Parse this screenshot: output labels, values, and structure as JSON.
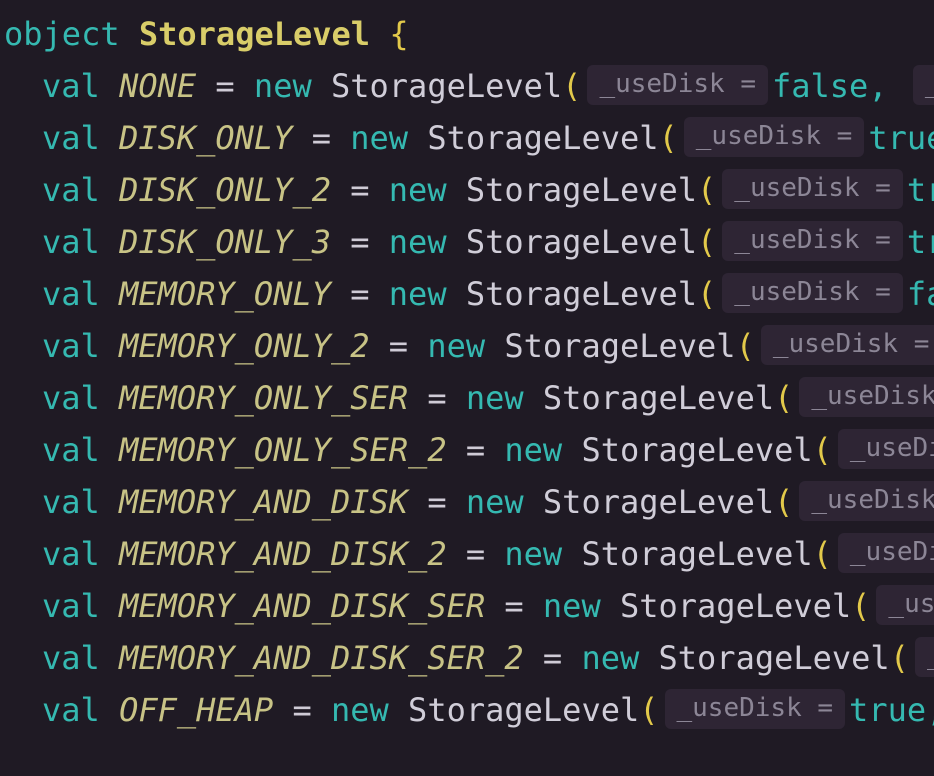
{
  "code": {
    "object_keyword": "object",
    "object_name": "StorageLevel",
    "open_brace": "{",
    "val_keyword": "val",
    "equals": "=",
    "new_keyword": "new",
    "type_name": "StorageLevel",
    "open_paren": "(",
    "param_hint": "_useDisk =",
    "lines": [
      {
        "name": "NONE",
        "value": "false,",
        "trail": " _u"
      },
      {
        "name": "DISK_ONLY",
        "value": "true",
        "trail": ""
      },
      {
        "name": "DISK_ONLY_2",
        "value": "tru",
        "trail": ""
      },
      {
        "name": "DISK_ONLY_3",
        "value": "tru",
        "trail": ""
      },
      {
        "name": "MEMORY_ONLY",
        "value": "fal",
        "trail": ""
      },
      {
        "name": "MEMORY_ONLY_2",
        "value": "",
        "trail": ""
      },
      {
        "name": "MEMORY_ONLY_SER",
        "value": "",
        "trail": ""
      },
      {
        "name": "MEMORY_ONLY_SER_2",
        "value": "",
        "trail": ""
      },
      {
        "name": "MEMORY_AND_DISK",
        "value": "",
        "trail": ""
      },
      {
        "name": "MEMORY_AND_DISK_2",
        "value": "",
        "trail": ""
      },
      {
        "name": "MEMORY_AND_DISK_SER",
        "value": "",
        "trail": ""
      },
      {
        "name": "MEMORY_AND_DISK_SER_2",
        "value": "",
        "trail": ""
      },
      {
        "name": "OFF_HEAP",
        "value": "true,",
        "trail": ""
      }
    ]
  }
}
